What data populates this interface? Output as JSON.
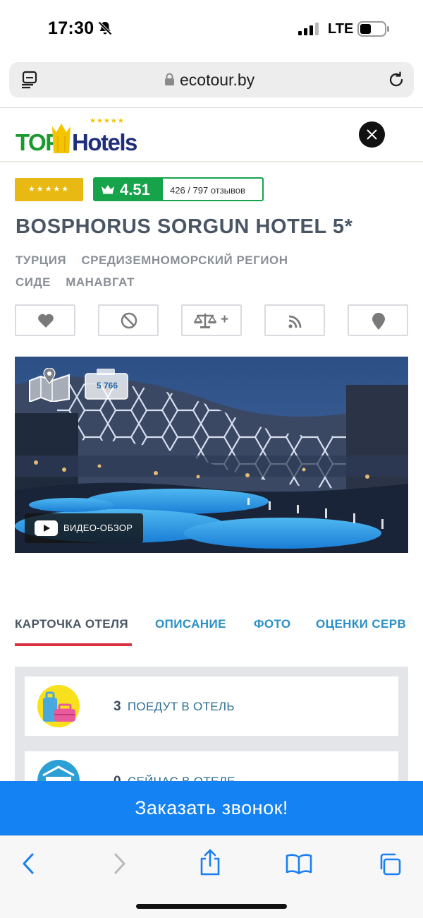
{
  "status_bar": {
    "time": "17:30",
    "network": "LTE"
  },
  "browser": {
    "url": "ecotour.by"
  },
  "site": {
    "logo_top": "TOP",
    "logo_hotels": "Hotels",
    "logo_stars": "★★★★★"
  },
  "hotel": {
    "stars": "★★★★★",
    "rating": "4.51",
    "reviews": "426 / 797 отзывов",
    "title": "BOSPHORUS SORGUN HOTEL 5*",
    "breadcrumb": [
      "ТУРЦИЯ",
      "СРЕДИЗЕМНОМОРСКИЙ РЕГИОН",
      "СИДЕ",
      "МАНАВГАТ"
    ],
    "photo_count": "5 766",
    "video_label": "ВИДЕО-ОБЗОР"
  },
  "actions": {
    "compare_plus": "+",
    "icons": [
      "heart-icon",
      "ban-icon",
      "scales-icon",
      "rss-icon",
      "map-pin-icon"
    ]
  },
  "tabs": [
    {
      "label": "КАРТОЧКА ОТЕЛЯ"
    },
    {
      "label": "ОПИСАНИЕ"
    },
    {
      "label": "ФОТО"
    },
    {
      "label": "ОЦЕНКИ СЕРВ"
    }
  ],
  "stats": [
    {
      "number": "3",
      "label": "ПОЕДУТ В ОТЕЛЬ"
    },
    {
      "number": "0",
      "label": "СЕЙЧАС В ОТЕЛЕ"
    }
  ],
  "call_button": "Заказать звонок!",
  "colors": {
    "accent_blue": "#1482f2",
    "rating_green": "#16a34a",
    "star_gold": "#e8b913",
    "tab_underline": "#d8303e",
    "link_blue": "#2a8fc4"
  }
}
